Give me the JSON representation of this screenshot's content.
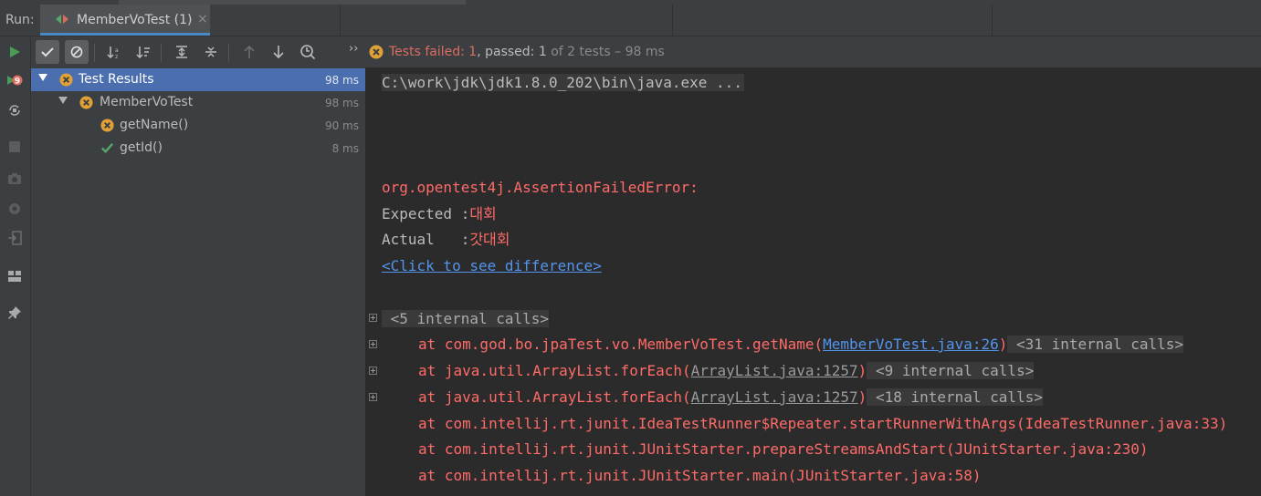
{
  "run_bar": {
    "label": "Run:",
    "tab_title": "MemberVoTest (1)",
    "close_glyph": "×"
  },
  "status": {
    "tests_failed": "Tests failed: ",
    "failed_count": "1",
    "passed_label": ", passed: ",
    "passed_count": "1",
    "of_label": " of 2 tests – 98 ms",
    "expand_glyph": "››"
  },
  "tree": {
    "rows": [
      {
        "label": "Test Results",
        "time": "98 ms",
        "status": "failed"
      },
      {
        "label": "MemberVoTest",
        "time": "98 ms",
        "status": "failed"
      },
      {
        "label": "getName()",
        "time": "90 ms",
        "status": "failed"
      },
      {
        "label": "getId()",
        "time": "8 ms",
        "status": "passed"
      }
    ]
  },
  "console": {
    "command": "C:\\work\\jdk\\jdk1.8.0_202\\bin\\java.exe ...",
    "error_class": "org.opentest4j.AssertionFailedError:",
    "expected_label": "Expected :",
    "expected_value": "대회",
    "actual_label": "Actual   :",
    "actual_value": "갓대회",
    "diff_link": "<Click to see difference>",
    "internal_calls_1": "<5 internal calls>",
    "stack": [
      {
        "prefix": "at com.god.bo.jpaTest.vo.MemberVoTest.getName(",
        "link": "MemberVoTest.java:26",
        "suffix": ")",
        "fold": "<31 internal calls>"
      },
      {
        "prefix": "at java.util.ArrayList.forEach(",
        "link": "ArrayList.java:1257",
        "suffix": ")",
        "fold": "<9 internal calls>"
      },
      {
        "prefix": "at java.util.ArrayList.forEach(",
        "link": "ArrayList.java:1257",
        "suffix": ")",
        "fold": "<18 internal calls>"
      },
      {
        "text": "at com.intellij.rt.junit.IdeaTestRunner$Repeater.startRunnerWithArgs(IdeaTestRunner.java:33)"
      },
      {
        "text": "at com.intellij.rt.junit.JUnitStarter.prepareStreamsAndStart(JUnitStarter.java:230)"
      },
      {
        "text": "at com.intellij.rt.junit.JUnitStarter.main(JUnitStarter.java:58)"
      }
    ]
  },
  "colors": {
    "error_red": "#ff6b68",
    "link_blue": "#5394ec",
    "selection": "#4b6eaf",
    "pass_green": "#59a869",
    "fail_orange": "#e0a236"
  }
}
